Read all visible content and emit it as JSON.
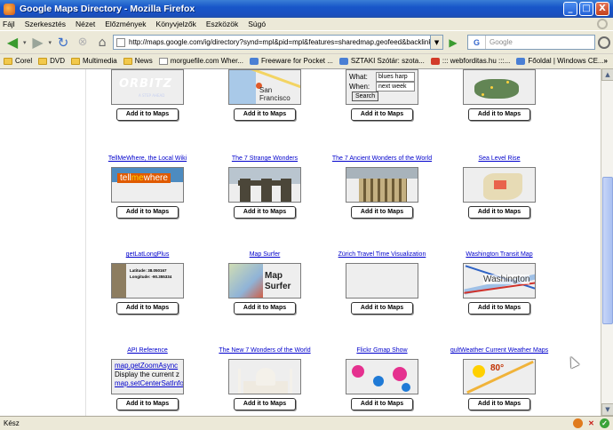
{
  "window": {
    "title": "Google Maps Directory - Mozilla Firefox",
    "controls": [
      "_",
      "□",
      "X"
    ]
  },
  "menu": [
    "Fájl",
    "Szerkesztés",
    "Nézet",
    "Előzmények",
    "Könyvjelzők",
    "Eszközök",
    "Súgó"
  ],
  "nav": {
    "url": "http://maps.google.com/ig/directory?synd=mpl&pid=mpl&features=sharedmap,geofeed&backlink=http:%2",
    "search_placeholder": "Google",
    "search_engine_icon": "G"
  },
  "bookmarks": [
    "Corel",
    "DVD",
    "Multimedia",
    "News",
    "morguefile.com Wher...",
    "Freeware for Pocket ...",
    "SZTAKI Szótár: szota...",
    "::: webforditas.hu :::...",
    "Főoldal | Windows CE..."
  ],
  "bookmarks_more": "»",
  "add_button_label": "Add it to Maps",
  "gadgets": {
    "r0c0": {
      "title": ""
    },
    "r0c0_brand": "ORBITZ",
    "r0c0_tag": "A STEP AHEAD",
    "r0c1": {
      "title": ""
    },
    "r0c1_label": "San Francisco",
    "r0c2": {
      "title": ""
    },
    "r0c2_what_label": "What:",
    "r0c2_what_value": "blues harp",
    "r0c2_when_label": "When:",
    "r0c2_when_value": "next week",
    "r0c2_button": "Search",
    "r0c3": {
      "title": ""
    },
    "r1c0": {
      "title": "TellMeWhere, the Local Wiki"
    },
    "r1c0_logo_a": "tell",
    "r1c0_logo_b": "me",
    "r1c0_logo_c": "where",
    "r1c1": {
      "title": "The 7 Strange Wonders"
    },
    "r1c2": {
      "title": "The 7 Ancient Wonders of the World"
    },
    "r1c3": {
      "title": "Sea Level Rise"
    },
    "r2c0": {
      "title": "getLatLongPlus"
    },
    "r2c0_lat": "Latitude: 38.050167",
    "r2c0_lng": "Longitude: -90.355334",
    "r2c1": {
      "title": "Map Surfer"
    },
    "r2c1_name_a": "Map",
    "r2c1_name_b": "Surfer",
    "r2c2": {
      "title": "Zürich Travel Time Visualization"
    },
    "r2c3": {
      "title": "Washington Transit Map"
    },
    "r2c3_label": "Washington",
    "r3c0": {
      "title": "API Reference"
    },
    "r3c0_fn1": "map.getZoomAsync",
    "r3c0_desc": "Display the current z",
    "r3c0_fn2": "map.setCenterSatInfo",
    "r3c1": {
      "title": "The New 7 Wonders of the World"
    },
    "r3c2": {
      "title": "Flickr Gmap Show"
    },
    "r3c3": {
      "title": "qultWeather Current Weather Maps"
    },
    "r3c3_temp": "80°"
  },
  "status": {
    "text": "Kész"
  },
  "colors": {
    "link": "#0000cc",
    "titlebar": "#1856c9",
    "chrome": "#ece9d8"
  }
}
